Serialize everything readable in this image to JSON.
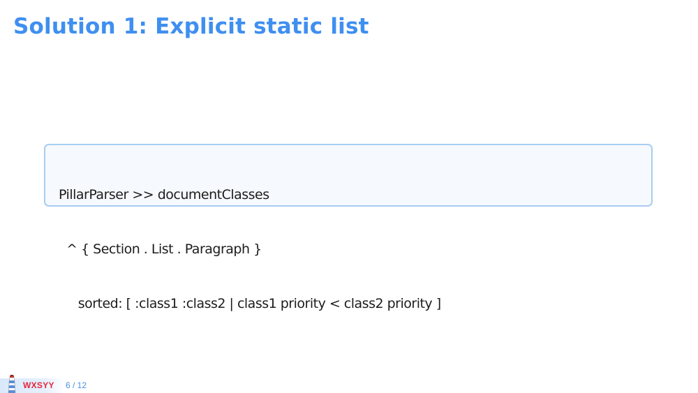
{
  "slide": {
    "title": "Solution 1: Explicit static list"
  },
  "code": {
    "lines": [
      "PillarParser >> documentClasses",
      "  ^ { Section . List . Paragraph }",
      "     sorted: [ :class1 :class2 | class1 priority < class2 priority ]"
    ]
  },
  "footer": {
    "brand": "WXSYY",
    "page_current": "6",
    "page_total": "12",
    "page_label": "6 / 12",
    "logo_icon": "lighthouse-icon"
  },
  "colors": {
    "title": "#3f8ff0",
    "code_border": "#a8cdf3",
    "code_background": "#f6f9fd",
    "brand": "#e8263c",
    "page_number": "#4a90e2"
  }
}
